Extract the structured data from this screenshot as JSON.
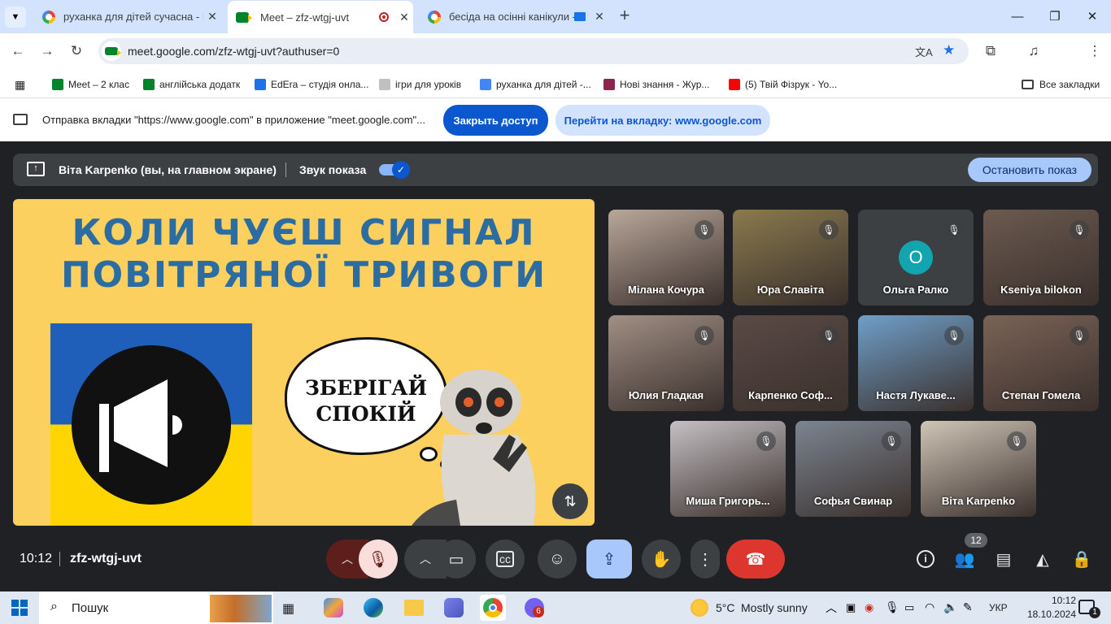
{
  "tabs": [
    {
      "title": "руханка для дітей сучасна - По",
      "close": "✕"
    },
    {
      "title": "Meet – zfz-wtgj-uvt",
      "close": "✕"
    },
    {
      "title": "бесіда на осінні канікули -",
      "close": "✕"
    }
  ],
  "new_tab": "+",
  "window": {
    "minimize": "—",
    "maximize": "❐",
    "close": "✕"
  },
  "toolbar": {
    "url": "meet.google.com/zfz-wtgj-uvt?authuser=0"
  },
  "bookmarks": [
    {
      "label": "Meet – 2 клас",
      "color": "#00832d"
    },
    {
      "label": "англійська додатк",
      "color": "#00832d"
    },
    {
      "label": "EdEra – студія онла...",
      "color": "#1a73e8"
    },
    {
      "label": "ігри для уроків",
      "color": "#c0c0c0"
    },
    {
      "label": "руханка для дітей -...",
      "color": "#4285f4"
    },
    {
      "label": "Нові знання - Жур...",
      "color": "#8e2450"
    },
    {
      "label": "(5) Твій Фізрук - Yo...",
      "color": "#ff0000"
    }
  ],
  "all_bookmarks": "Все закладки",
  "sharebar": {
    "message": "Отправка вкладки \"https://www.google.com\" в приложение \"meet.google.com\"...",
    "stop_button": "Закрыть доступ",
    "switch_button": "Перейти на вкладку: www.google.com"
  },
  "presentation": {
    "presenter": "Віта Karpenko (вы, на главном экране)",
    "audio_label": "Звук показа",
    "audio_on": true,
    "stop_button": "Остановить показ"
  },
  "slide": {
    "title_line1": "КОЛИ ЧУЄШ СИГНАЛ",
    "title_line2": "ПОВІТРЯНОЇ ТРИВОГИ",
    "bubble_line1": "ЗБЕРІГАЙ",
    "bubble_line2": "СПОКІЙ",
    "title_color": "#2b6ca3",
    "bg_color": "#fcd05f"
  },
  "participants": [
    {
      "name": "Мілана Кочура",
      "bg": "#b9a79a"
    },
    {
      "name": "Юра Славіта",
      "bg": "#8a7a4e"
    },
    {
      "name": "Ольга Ралко",
      "bg": "#3c4043",
      "avatar": "О"
    },
    {
      "name": "Kseniya bilokon",
      "bg": "#6b5a4f"
    },
    {
      "name": "Юлия Гладкая",
      "bg": "#a08f84"
    },
    {
      "name": "Карпенко Соф...",
      "bg": "#5a4a45"
    },
    {
      "name": "Настя Лукаве...",
      "bg": "#6f9fc9"
    },
    {
      "name": "Степан Гомела",
      "bg": "#7a6356"
    },
    {
      "name": "Миша Григорь...",
      "bg": "#c5c0c4"
    },
    {
      "name": "Софья Свинар",
      "bg": "#7c8591"
    },
    {
      "name": "Віта Karpenko",
      "bg": "#cfc6b7"
    }
  ],
  "bottom": {
    "time": "10:12",
    "meeting_code": "zfz-wtgj-uvt",
    "people_count": "12"
  },
  "taskbar": {
    "search": "Пошук",
    "weather_temp": "5°C",
    "weather_desc": "Mostly sunny",
    "lang": "УКР",
    "time": "10:12",
    "date": "18.10.2024",
    "viber_badge": "6",
    "notif_badge": "1"
  }
}
